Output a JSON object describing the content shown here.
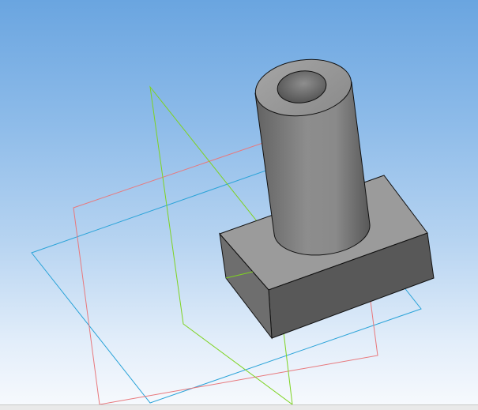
{
  "viewport": {
    "background": {
      "top": "#6aa5e0",
      "bottom": "#f6f9fd"
    }
  },
  "scene": {
    "planes": [
      {
        "name": "plane-xy",
        "color": "#2aa3d8"
      },
      {
        "name": "plane-zx",
        "color": "#e8787c"
      },
      {
        "name": "plane-zy",
        "color": "#7ed321"
      }
    ],
    "model": {
      "name": "boss-on-block-part",
      "colors": {
        "top": "#9b9b9b",
        "front": "#575757",
        "side": "#6e6e6e",
        "edge": "#111111",
        "cylinder_light": "#9a9a9a",
        "cylinder_dark": "#555555"
      }
    }
  }
}
